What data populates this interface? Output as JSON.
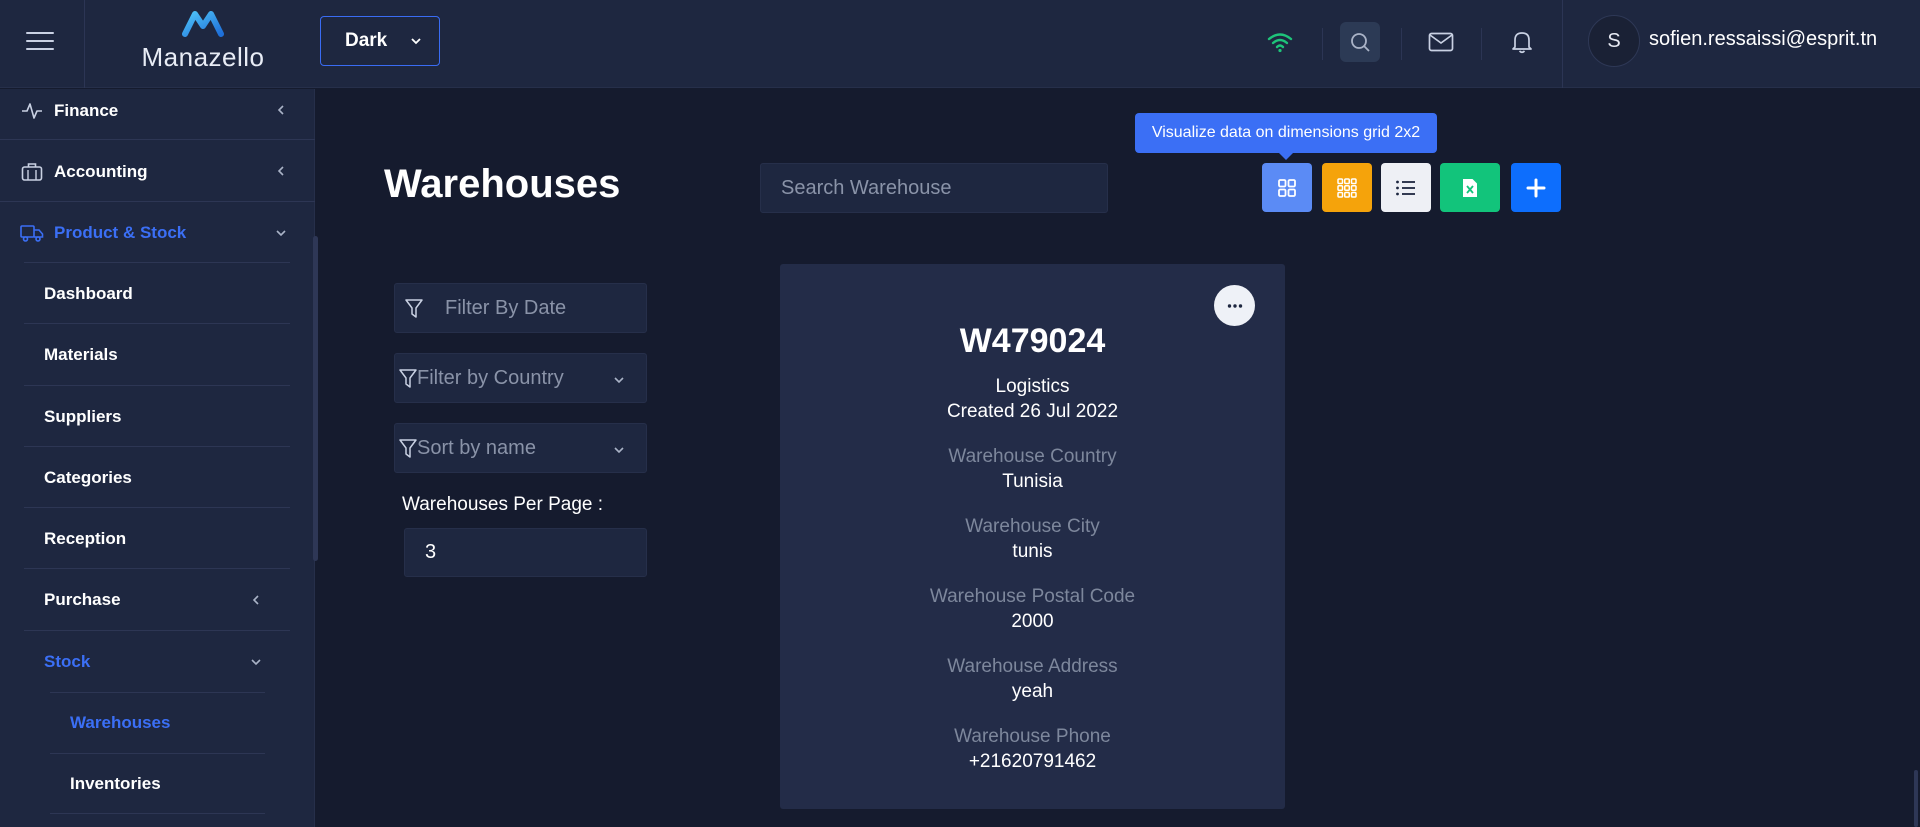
{
  "header": {
    "brand": "Manazello",
    "theme_select": "Dark",
    "user_initial": "S",
    "user_email": "sofien.ressaissi@esprit.tn",
    "icons": [
      "menu-icon",
      "wifi-icon",
      "search-icon",
      "mail-icon",
      "bell-icon"
    ]
  },
  "sidebar": {
    "items": {
      "finance": "Finance",
      "accounting": "Accounting",
      "product_stock": "Product & Stock",
      "dashboard": "Dashboard",
      "materials": "Materials",
      "suppliers": "Suppliers",
      "categories": "Categories",
      "reception": "Reception",
      "purchase": "Purchase",
      "stock": "Stock",
      "warehouses": "Warehouses",
      "inventories": "Inventories"
    },
    "active_color": "#3b6ff5"
  },
  "main": {
    "title": "Warehouses",
    "search_placeholder": "Search Warehouse",
    "tooltip": "Visualize data on dimensions grid 2x2",
    "toolbar_colors": {
      "grid2x2": "#5b8bf5",
      "grid3x3": "#f5a30b",
      "list": "#eef0f5",
      "excel": "#12c47b",
      "add": "#0d6efd"
    },
    "filters": {
      "date_placeholder": "Filter By Date",
      "country_placeholder": "Filter by Country",
      "sort_placeholder": "Sort by name",
      "per_page_label": "Warehouses Per Page :",
      "per_page_value": "3"
    }
  },
  "card": {
    "code": "W479024",
    "type": "Logistics",
    "created": "Created 26 Jul 2022",
    "fields": [
      {
        "label": "Warehouse Country",
        "value": "Tunisia"
      },
      {
        "label": "Warehouse City",
        "value": "tunis"
      },
      {
        "label": "Warehouse Postal Code",
        "value": "2000"
      },
      {
        "label": "Warehouse Address",
        "value": "yeah"
      },
      {
        "label": "Warehouse Phone",
        "value": "+21620791462"
      }
    ]
  }
}
